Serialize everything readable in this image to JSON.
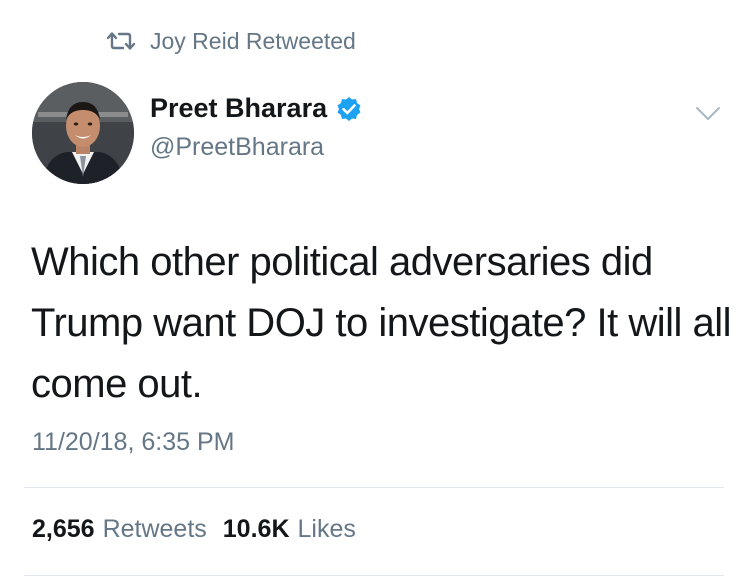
{
  "retweet_context": {
    "text": "Joy Reid Retweeted",
    "icon": "retweet-icon"
  },
  "author": {
    "name": "Preet Bharara",
    "handle": "@PreetBharara",
    "verified": true,
    "verified_color": "#1da1f2"
  },
  "tweet": {
    "text": "Which other political adversaries did Trump want DOJ to investigate? It will all come out.",
    "timestamp": "11/20/18, 6:35 PM"
  },
  "stats": {
    "retweets_count": "2,656",
    "retweets_label": "Retweets",
    "likes_count": "10.6K",
    "likes_label": "Likes"
  },
  "colors": {
    "text_primary": "#14171a",
    "text_secondary": "#657786",
    "divider": "#e1e8ed",
    "accent": "#1da1f2"
  }
}
